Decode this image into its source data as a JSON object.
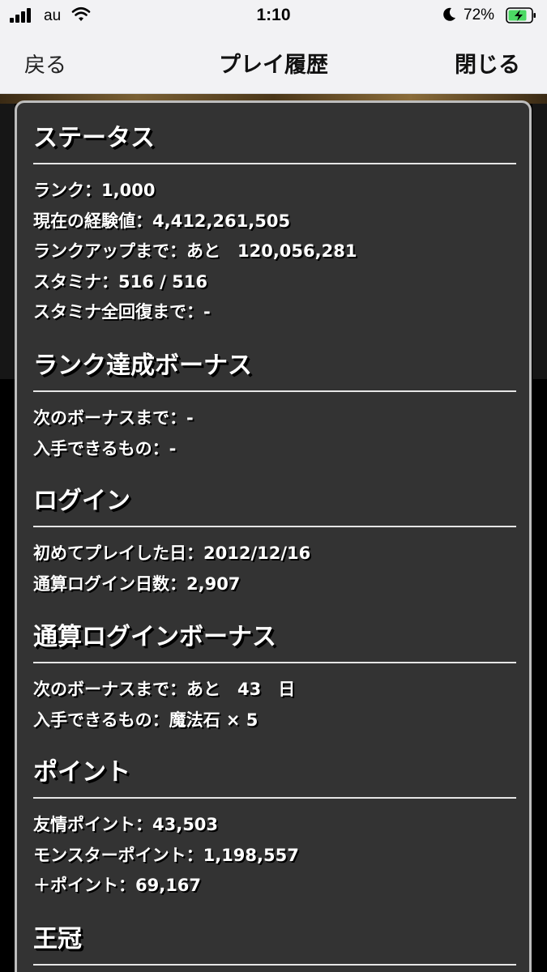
{
  "status_bar": {
    "carrier": "au",
    "time": "1:10",
    "battery_percent": "72%",
    "icons": [
      "signal-icon",
      "wifi-icon",
      "moon-icon",
      "battery-charging-icon"
    ]
  },
  "nav": {
    "back_label": "戻る",
    "title": "プレイ履歴",
    "close_label": "閉じる"
  },
  "sections": [
    {
      "title": "ステータス",
      "rows": [
        "ランク：1,000",
        "現在の経験値：4,412,261,505",
        "ランクアップまで：あと　120,056,281",
        "スタミナ：516 / 516",
        "スタミナ全回復まで：-"
      ]
    },
    {
      "title": "ランク達成ボーナス",
      "rows": [
        "次のボーナスまで：-",
        "入手できるもの：-"
      ]
    },
    {
      "title": "ログイン",
      "rows": [
        "初めてプレイした日：2012/12/16",
        "通算ログイン日数：2,907"
      ]
    },
    {
      "title": "通算ログインボーナス",
      "rows": [
        "次のボーナスまで：あと　43　日",
        "入手できるもの：魔法石 × 5"
      ]
    },
    {
      "title": "ポイント",
      "rows": [
        "友情ポイント：43,503",
        "モンスターポイント：1,198,557",
        "＋ポイント：69,167"
      ]
    },
    {
      "title": "王冠",
      "rows": []
    }
  ],
  "colors": {
    "panel_bg": "#333333",
    "panel_border": "#bdbdbd",
    "bar_bg": "#f2f2f4",
    "battery_fill": "#4cd964"
  }
}
